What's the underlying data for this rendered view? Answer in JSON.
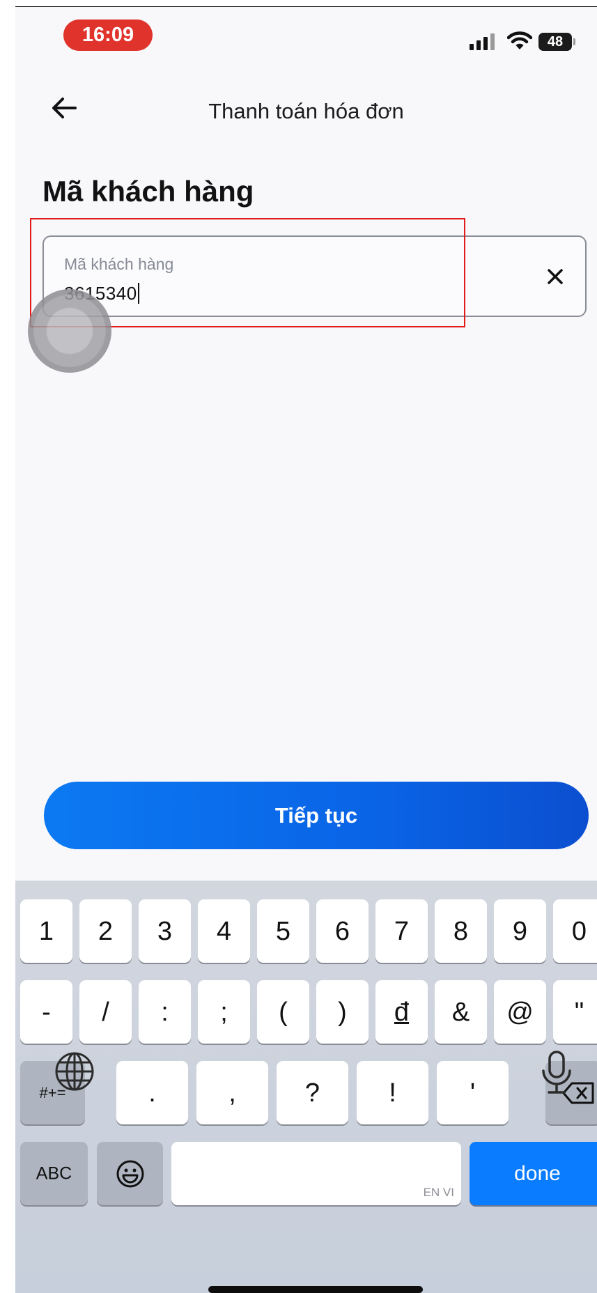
{
  "status_bar": {
    "time": "16:09",
    "battery": "48"
  },
  "header": {
    "title": "Thanh toán hóa đơn"
  },
  "page": {
    "title": "Mã khách hàng"
  },
  "customer_field": {
    "label": "Mã khách hàng",
    "value": "3615340"
  },
  "continue_button": {
    "label": "Tiếp tục"
  },
  "keyboard": {
    "row1": [
      "1",
      "2",
      "3",
      "4",
      "5",
      "6",
      "7",
      "8",
      "9",
      "0"
    ],
    "row2": [
      "-",
      "/",
      ":",
      ";",
      "(",
      ")",
      "đ",
      "&",
      "@",
      "\""
    ],
    "row3": [
      ".",
      ",",
      "?",
      "!",
      "'"
    ],
    "symbols_key": "#+=",
    "abc_key": "ABC",
    "space_hint": "EN VI",
    "done_key": "done"
  },
  "colors": {
    "accent": "#0a7cff",
    "time_pill": "#e0332c",
    "highlight": "#e11a1a"
  }
}
